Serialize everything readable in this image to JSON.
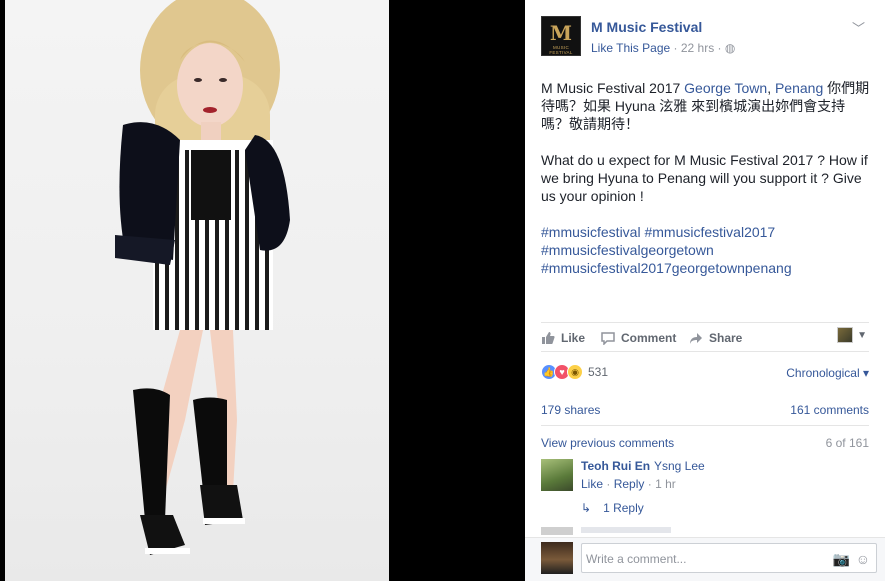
{
  "page": {
    "name": "M Music Festival",
    "logo_main": "M",
    "logo_sub": "MUSIC FESTIVAL",
    "like_page": "Like This Page",
    "dot": " · ",
    "time": "22 hrs",
    "privacy_icon": "globe-icon"
  },
  "post": {
    "line1_prefix": "M Music Festival 2017 ",
    "loc1": "George Town",
    "sep": ", ",
    "loc2": "Penang",
    "line1_rest": " 你們期待嗎？如果 Hyuna 泫雅 來到檳城演出妳們會支持嗎？敬請期待！",
    "para2": "What do u expect for M Music Festival 2017 ? How if we bring Hyuna to Penang will you support it ? Give us your opinion !",
    "hashtags": [
      "#mmusicfestival",
      "#mmusicfestival2017",
      "#mmusicfestivalgeorgetown",
      "#mmusicfestival2017georgetownpenang"
    ]
  },
  "actions": {
    "like": "Like",
    "comment": "Comment",
    "share": "Share"
  },
  "reactions": {
    "count": "531",
    "types": [
      "like",
      "love",
      "wow"
    ]
  },
  "ordering": "Chronological ▾",
  "stats": {
    "shares": "179 shares",
    "comments": "161 comments"
  },
  "comments": {
    "view_previous": "View previous comments",
    "paging": "6 of 161",
    "items": [
      {
        "author": "Teoh Rui En",
        "text": "Ysng Lee",
        "like": "Like",
        "reply": "Reply",
        "time": "1 hr",
        "replies": "1 Reply"
      }
    ]
  },
  "composer": {
    "placeholder": "Write a comment..."
  },
  "colors": {
    "link": "#365899",
    "muted": "#90949c",
    "text": "#1d2129",
    "background": "#000000"
  }
}
